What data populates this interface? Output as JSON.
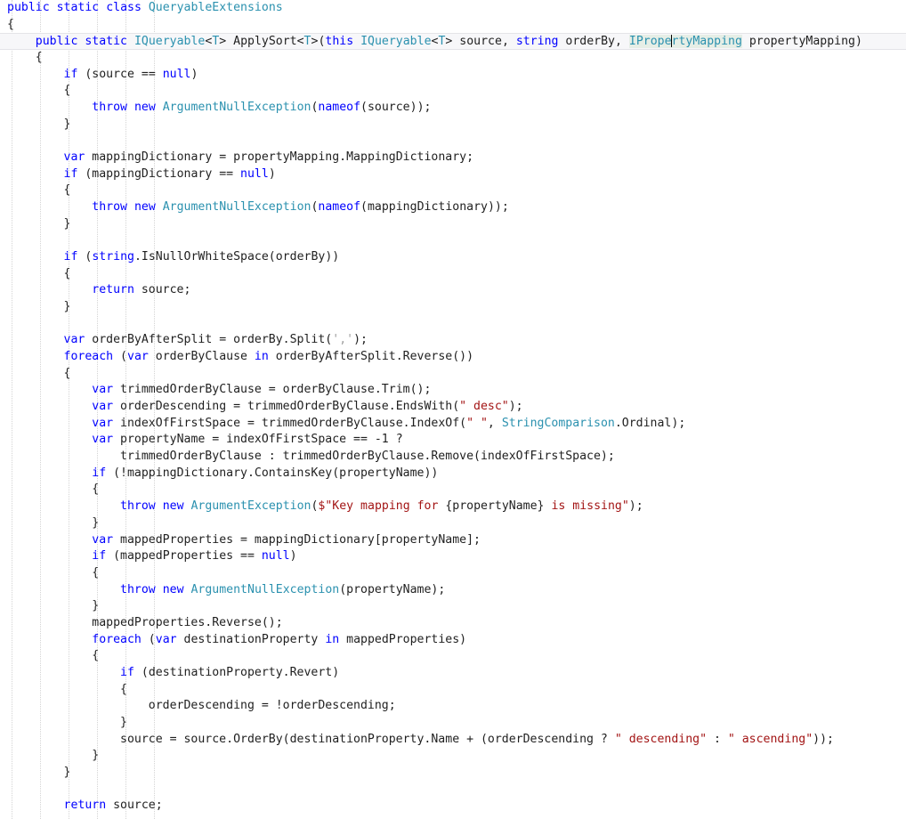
{
  "editor": {
    "language": "csharp",
    "font_size_px": 13.2,
    "line_height_px": 18.68,
    "background": "#ffffff",
    "current_line_index": 2,
    "caret": {
      "line": 2,
      "column_after": "IPrope"
    },
    "colors": {
      "keyword": "#0000ff",
      "type": "#2b91af",
      "string": "#a31515",
      "char_literal": "#a0a0a0",
      "plain": "#1f1f1f",
      "indent_guide": "#d4d4d4",
      "current_line_band": "#f7f7f9",
      "current_line_border": "#e4e4e8",
      "selection_highlight": "#e6eee6"
    },
    "indent_guides_x": [
      13,
      45,
      77,
      109,
      141,
      173
    ],
    "selected_symbol": "IPropertyMapping"
  },
  "lines": [
    {
      "n": 1,
      "indent": 0,
      "current": false,
      "tokens": [
        {
          "t": "k",
          "v": "public"
        },
        {
          "t": "p",
          "v": " "
        },
        {
          "t": "k",
          "v": "static"
        },
        {
          "t": "p",
          "v": " "
        },
        {
          "t": "k",
          "v": "class"
        },
        {
          "t": "p",
          "v": " "
        },
        {
          "t": "t",
          "v": "QueryableExtensions"
        }
      ]
    },
    {
      "n": 2,
      "indent": 0,
      "current": false,
      "tokens": [
        {
          "t": "p",
          "v": "{"
        }
      ]
    },
    {
      "n": 3,
      "indent": 0,
      "current": true,
      "tokens": [
        {
          "t": "p",
          "v": "    "
        },
        {
          "t": "k",
          "v": "public"
        },
        {
          "t": "p",
          "v": " "
        },
        {
          "t": "k",
          "v": "static"
        },
        {
          "t": "p",
          "v": " "
        },
        {
          "t": "t",
          "v": "IQueryable"
        },
        {
          "t": "p",
          "v": "<"
        },
        {
          "t": "t",
          "v": "T"
        },
        {
          "t": "p",
          "v": "> ApplySort<"
        },
        {
          "t": "t",
          "v": "T"
        },
        {
          "t": "p",
          "v": ">("
        },
        {
          "t": "k",
          "v": "this"
        },
        {
          "t": "p",
          "v": " "
        },
        {
          "t": "t",
          "v": "IQueryable"
        },
        {
          "t": "p",
          "v": "<"
        },
        {
          "t": "t",
          "v": "T"
        },
        {
          "t": "p",
          "v": "> source, "
        },
        {
          "t": "k",
          "v": "string"
        },
        {
          "t": "p",
          "v": " orderBy, "
        },
        {
          "t": "sel-caret",
          "v": "IPropertyMapping",
          "caret_after": 6
        },
        {
          "t": "p",
          "v": " propertyMapping)"
        }
      ]
    },
    {
      "n": 4,
      "indent": 0,
      "current": false,
      "tokens": [
        {
          "t": "p",
          "v": "    {"
        }
      ]
    },
    {
      "n": 5,
      "indent": 0,
      "current": false,
      "tokens": [
        {
          "t": "p",
          "v": "        "
        },
        {
          "t": "k",
          "v": "if"
        },
        {
          "t": "p",
          "v": " (source == "
        },
        {
          "t": "k",
          "v": "null"
        },
        {
          "t": "p",
          "v": ")"
        }
      ]
    },
    {
      "n": 6,
      "indent": 0,
      "current": false,
      "tokens": [
        {
          "t": "p",
          "v": "        {"
        }
      ]
    },
    {
      "n": 7,
      "indent": 0,
      "current": false,
      "tokens": [
        {
          "t": "p",
          "v": "            "
        },
        {
          "t": "k",
          "v": "throw"
        },
        {
          "t": "p",
          "v": " "
        },
        {
          "t": "k",
          "v": "new"
        },
        {
          "t": "p",
          "v": " "
        },
        {
          "t": "t",
          "v": "ArgumentNullException"
        },
        {
          "t": "p",
          "v": "("
        },
        {
          "t": "k",
          "v": "nameof"
        },
        {
          "t": "p",
          "v": "(source));"
        }
      ]
    },
    {
      "n": 8,
      "indent": 0,
      "current": false,
      "tokens": [
        {
          "t": "p",
          "v": "        }"
        }
      ]
    },
    {
      "n": 9,
      "indent": 0,
      "current": false,
      "tokens": []
    },
    {
      "n": 10,
      "indent": 0,
      "current": false,
      "tokens": [
        {
          "t": "p",
          "v": "        "
        },
        {
          "t": "k",
          "v": "var"
        },
        {
          "t": "p",
          "v": " mappingDictionary = propertyMapping.MappingDictionary;"
        }
      ]
    },
    {
      "n": 11,
      "indent": 0,
      "current": false,
      "tokens": [
        {
          "t": "p",
          "v": "        "
        },
        {
          "t": "k",
          "v": "if"
        },
        {
          "t": "p",
          "v": " (mappingDictionary == "
        },
        {
          "t": "k",
          "v": "null"
        },
        {
          "t": "p",
          "v": ")"
        }
      ]
    },
    {
      "n": 12,
      "indent": 0,
      "current": false,
      "tokens": [
        {
          "t": "p",
          "v": "        {"
        }
      ]
    },
    {
      "n": 13,
      "indent": 0,
      "current": false,
      "tokens": [
        {
          "t": "p",
          "v": "            "
        },
        {
          "t": "k",
          "v": "throw"
        },
        {
          "t": "p",
          "v": " "
        },
        {
          "t": "k",
          "v": "new"
        },
        {
          "t": "p",
          "v": " "
        },
        {
          "t": "t",
          "v": "ArgumentNullException"
        },
        {
          "t": "p",
          "v": "("
        },
        {
          "t": "k",
          "v": "nameof"
        },
        {
          "t": "p",
          "v": "(mappingDictionary));"
        }
      ]
    },
    {
      "n": 14,
      "indent": 0,
      "current": false,
      "tokens": [
        {
          "t": "p",
          "v": "        }"
        }
      ]
    },
    {
      "n": 15,
      "indent": 0,
      "current": false,
      "tokens": []
    },
    {
      "n": 16,
      "indent": 0,
      "current": false,
      "tokens": [
        {
          "t": "p",
          "v": "        "
        },
        {
          "t": "k",
          "v": "if"
        },
        {
          "t": "p",
          "v": " ("
        },
        {
          "t": "k",
          "v": "string"
        },
        {
          "t": "p",
          "v": ".IsNullOrWhiteSpace(orderBy))"
        }
      ]
    },
    {
      "n": 17,
      "indent": 0,
      "current": false,
      "tokens": [
        {
          "t": "p",
          "v": "        {"
        }
      ]
    },
    {
      "n": 18,
      "indent": 0,
      "current": false,
      "tokens": [
        {
          "t": "p",
          "v": "            "
        },
        {
          "t": "k",
          "v": "return"
        },
        {
          "t": "p",
          "v": " source;"
        }
      ]
    },
    {
      "n": 19,
      "indent": 0,
      "current": false,
      "tokens": [
        {
          "t": "p",
          "v": "        }"
        }
      ]
    },
    {
      "n": 20,
      "indent": 0,
      "current": false,
      "tokens": []
    },
    {
      "n": 21,
      "indent": 0,
      "current": false,
      "tokens": [
        {
          "t": "p",
          "v": "        "
        },
        {
          "t": "k",
          "v": "var"
        },
        {
          "t": "p",
          "v": " orderByAfterSplit = orderBy.Split("
        },
        {
          "t": "ch",
          "v": "','"
        },
        {
          "t": "p",
          "v": ");"
        }
      ]
    },
    {
      "n": 22,
      "indent": 0,
      "current": false,
      "tokens": [
        {
          "t": "p",
          "v": "        "
        },
        {
          "t": "k",
          "v": "foreach"
        },
        {
          "t": "p",
          "v": " ("
        },
        {
          "t": "k",
          "v": "var"
        },
        {
          "t": "p",
          "v": " orderByClause "
        },
        {
          "t": "k",
          "v": "in"
        },
        {
          "t": "p",
          "v": " orderByAfterSplit.Reverse())"
        }
      ]
    },
    {
      "n": 23,
      "indent": 0,
      "current": false,
      "tokens": [
        {
          "t": "p",
          "v": "        {"
        }
      ]
    },
    {
      "n": 24,
      "indent": 0,
      "current": false,
      "tokens": [
        {
          "t": "p",
          "v": "            "
        },
        {
          "t": "k",
          "v": "var"
        },
        {
          "t": "p",
          "v": " trimmedOrderByClause = orderByClause.Trim();"
        }
      ]
    },
    {
      "n": 25,
      "indent": 0,
      "current": false,
      "tokens": [
        {
          "t": "p",
          "v": "            "
        },
        {
          "t": "k",
          "v": "var"
        },
        {
          "t": "p",
          "v": " orderDescending = trimmedOrderByClause.EndsWith("
        },
        {
          "t": "s",
          "v": "\" desc\""
        },
        {
          "t": "p",
          "v": ");"
        }
      ]
    },
    {
      "n": 26,
      "indent": 0,
      "current": false,
      "tokens": [
        {
          "t": "p",
          "v": "            "
        },
        {
          "t": "k",
          "v": "var"
        },
        {
          "t": "p",
          "v": " indexOfFirstSpace = trimmedOrderByClause.IndexOf("
        },
        {
          "t": "s",
          "v": "\" \""
        },
        {
          "t": "p",
          "v": ", "
        },
        {
          "t": "t",
          "v": "StringComparison"
        },
        {
          "t": "p",
          "v": ".Ordinal);"
        }
      ]
    },
    {
      "n": 27,
      "indent": 0,
      "current": false,
      "tokens": [
        {
          "t": "p",
          "v": "            "
        },
        {
          "t": "k",
          "v": "var"
        },
        {
          "t": "p",
          "v": " propertyName = indexOfFirstSpace == -1 ?"
        }
      ]
    },
    {
      "n": 28,
      "indent": 0,
      "current": false,
      "tokens": [
        {
          "t": "p",
          "v": "                trimmedOrderByClause : trimmedOrderByClause.Remove(indexOfFirstSpace);"
        }
      ]
    },
    {
      "n": 29,
      "indent": 0,
      "current": false,
      "tokens": [
        {
          "t": "p",
          "v": "            "
        },
        {
          "t": "k",
          "v": "if"
        },
        {
          "t": "p",
          "v": " (!mappingDictionary.ContainsKey(propertyName))"
        }
      ]
    },
    {
      "n": 30,
      "indent": 0,
      "current": false,
      "tokens": [
        {
          "t": "p",
          "v": "            {"
        }
      ]
    },
    {
      "n": 31,
      "indent": 0,
      "current": false,
      "tokens": [
        {
          "t": "p",
          "v": "                "
        },
        {
          "t": "k",
          "v": "throw"
        },
        {
          "t": "p",
          "v": " "
        },
        {
          "t": "k",
          "v": "new"
        },
        {
          "t": "p",
          "v": " "
        },
        {
          "t": "t",
          "v": "ArgumentException"
        },
        {
          "t": "p",
          "v": "("
        },
        {
          "t": "s",
          "v": "$\"Key mapping for "
        },
        {
          "t": "p",
          "v": "{propertyName}"
        },
        {
          "t": "s",
          "v": " is missing\""
        },
        {
          "t": "p",
          "v": ");"
        }
      ]
    },
    {
      "n": 32,
      "indent": 0,
      "current": false,
      "tokens": [
        {
          "t": "p",
          "v": "            }"
        }
      ]
    },
    {
      "n": 33,
      "indent": 0,
      "current": false,
      "tokens": [
        {
          "t": "p",
          "v": "            "
        },
        {
          "t": "k",
          "v": "var"
        },
        {
          "t": "p",
          "v": " mappedProperties = mappingDictionary[propertyName];"
        }
      ]
    },
    {
      "n": 34,
      "indent": 0,
      "current": false,
      "tokens": [
        {
          "t": "p",
          "v": "            "
        },
        {
          "t": "k",
          "v": "if"
        },
        {
          "t": "p",
          "v": " (mappedProperties == "
        },
        {
          "t": "k",
          "v": "null"
        },
        {
          "t": "p",
          "v": ")"
        }
      ]
    },
    {
      "n": 35,
      "indent": 0,
      "current": false,
      "tokens": [
        {
          "t": "p",
          "v": "            {"
        }
      ]
    },
    {
      "n": 36,
      "indent": 0,
      "current": false,
      "tokens": [
        {
          "t": "p",
          "v": "                "
        },
        {
          "t": "k",
          "v": "throw"
        },
        {
          "t": "p",
          "v": " "
        },
        {
          "t": "k",
          "v": "new"
        },
        {
          "t": "p",
          "v": " "
        },
        {
          "t": "t",
          "v": "ArgumentNullException"
        },
        {
          "t": "p",
          "v": "(propertyName);"
        }
      ]
    },
    {
      "n": 37,
      "indent": 0,
      "current": false,
      "tokens": [
        {
          "t": "p",
          "v": "            }"
        }
      ]
    },
    {
      "n": 38,
      "indent": 0,
      "current": false,
      "tokens": [
        {
          "t": "p",
          "v": "            mappedProperties.Reverse();"
        }
      ]
    },
    {
      "n": 39,
      "indent": 0,
      "current": false,
      "tokens": [
        {
          "t": "p",
          "v": "            "
        },
        {
          "t": "k",
          "v": "foreach"
        },
        {
          "t": "p",
          "v": " ("
        },
        {
          "t": "k",
          "v": "var"
        },
        {
          "t": "p",
          "v": " destinationProperty "
        },
        {
          "t": "k",
          "v": "in"
        },
        {
          "t": "p",
          "v": " mappedProperties)"
        }
      ]
    },
    {
      "n": 40,
      "indent": 0,
      "current": false,
      "tokens": [
        {
          "t": "p",
          "v": "            {"
        }
      ]
    },
    {
      "n": 41,
      "indent": 0,
      "current": false,
      "tokens": [
        {
          "t": "p",
          "v": "                "
        },
        {
          "t": "k",
          "v": "if"
        },
        {
          "t": "p",
          "v": " (destinationProperty.Revert)"
        }
      ]
    },
    {
      "n": 42,
      "indent": 0,
      "current": false,
      "tokens": [
        {
          "t": "p",
          "v": "                {"
        }
      ]
    },
    {
      "n": 43,
      "indent": 0,
      "current": false,
      "tokens": [
        {
          "t": "p",
          "v": "                    orderDescending = !orderDescending;"
        }
      ]
    },
    {
      "n": 44,
      "indent": 0,
      "current": false,
      "tokens": [
        {
          "t": "p",
          "v": "                }"
        }
      ]
    },
    {
      "n": 45,
      "indent": 0,
      "current": false,
      "tokens": [
        {
          "t": "p",
          "v": "                source = source.OrderBy(destinationProperty.Name + (orderDescending ? "
        },
        {
          "t": "s",
          "v": "\" descending\""
        },
        {
          "t": "p",
          "v": " : "
        },
        {
          "t": "s",
          "v": "\" ascending\""
        },
        {
          "t": "p",
          "v": "));"
        }
      ]
    },
    {
      "n": 46,
      "indent": 0,
      "current": false,
      "tokens": [
        {
          "t": "p",
          "v": "            }"
        }
      ]
    },
    {
      "n": 47,
      "indent": 0,
      "current": false,
      "tokens": [
        {
          "t": "p",
          "v": "        }"
        }
      ]
    },
    {
      "n": 48,
      "indent": 0,
      "current": false,
      "tokens": []
    },
    {
      "n": 49,
      "indent": 0,
      "current": false,
      "tokens": [
        {
          "t": "p",
          "v": "        "
        },
        {
          "t": "k",
          "v": "return"
        },
        {
          "t": "p",
          "v": " source;"
        }
      ]
    }
  ]
}
